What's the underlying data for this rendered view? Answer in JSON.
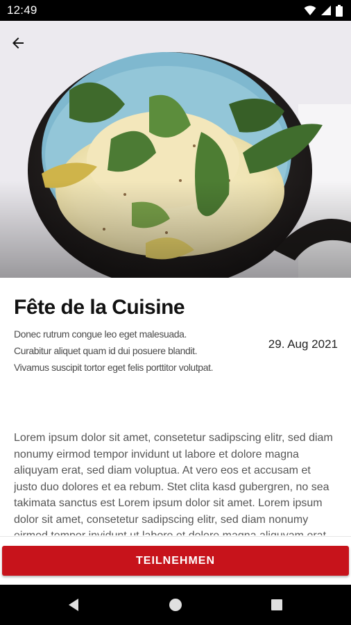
{
  "status_bar": {
    "time": "12:49",
    "icons": [
      "wifi-icon",
      "signal-icon",
      "battery-icon"
    ]
  },
  "hero": {
    "image_alt": "dish photo",
    "back_icon": "arrow-back-icon"
  },
  "event": {
    "title": "Fête de la Cuisine",
    "subtitle": "Donec rutrum congue leo eget malesuada. Curabitur aliquet quam id dui posuere blandit. Vivamus suscipit tortor eget felis porttitor volutpat.",
    "date": "29. Aug 2021",
    "description": "Lorem ipsum dolor sit amet, consetetur sadipscing elitr, sed diam nonumy eirmod tempor invidunt ut labore et dolore magna aliquyam erat, sed diam voluptua. At vero eos et accusam et justo duo dolores et ea rebum. Stet clita kasd gubergren, no sea takimata sanctus est Lorem ipsum dolor sit amet. Lorem ipsum dolor sit amet, consetetur sadipscing elitr, sed diam nonumy eirmod tempor invidunt ut labore et dolore magna aliquyam erat."
  },
  "actions": {
    "join_label": "TEILNEHMEN"
  },
  "colors": {
    "accent": "#c7131b",
    "status_bar": "#000000"
  },
  "nav_bar": {
    "icons": [
      "nav-back-icon",
      "nav-home-icon",
      "nav-recents-icon"
    ]
  }
}
